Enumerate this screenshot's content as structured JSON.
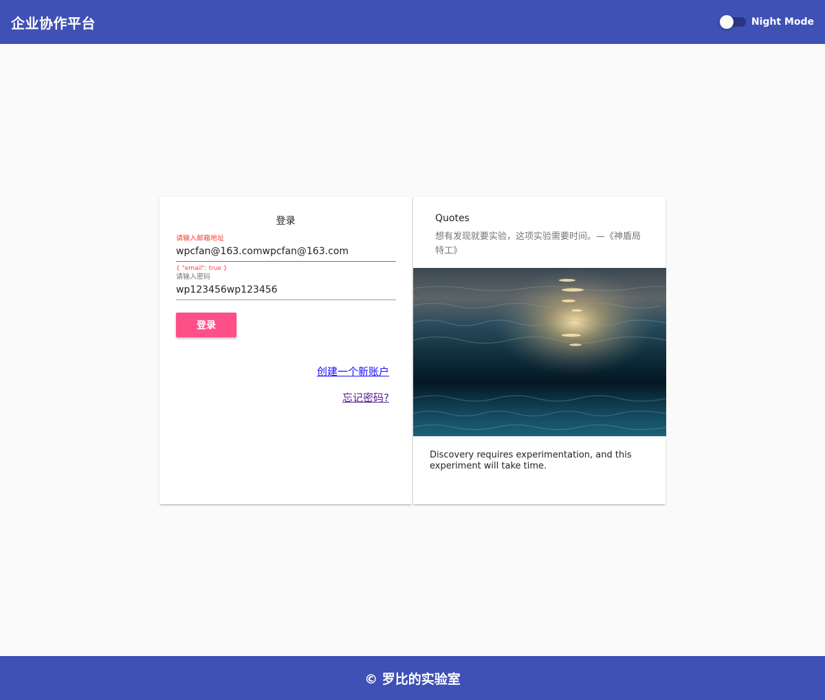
{
  "header": {
    "title": "企业协作平台",
    "night_mode_label": "Night Mode",
    "night_mode_on": false
  },
  "login": {
    "title": "登录",
    "email": {
      "label": "请输入邮箱地址",
      "value": "wpcfan@163.comwpcfan@163.com",
      "error": "{ \"email\": true }"
    },
    "password": {
      "label": "请输入密码",
      "value": "wp123456wp123456"
    },
    "submit_label": "登录",
    "create_account_link": "创建一个新账户",
    "forgot_password_link": "忘记密码?"
  },
  "quote_card": {
    "title": "Quotes",
    "subtitle": "想有发现就要实验，这项实验需要时间。—《神盾局特工》",
    "image": "ocean-waves-sunset",
    "text": "Discovery requires experimentation, and this experiment will take time."
  },
  "footer": {
    "text": "© 罗比的实验室"
  },
  "colors": {
    "primary": "#3f51b5",
    "accent": "#ff4f88",
    "error": "#f44336",
    "background": "#fafafa"
  }
}
